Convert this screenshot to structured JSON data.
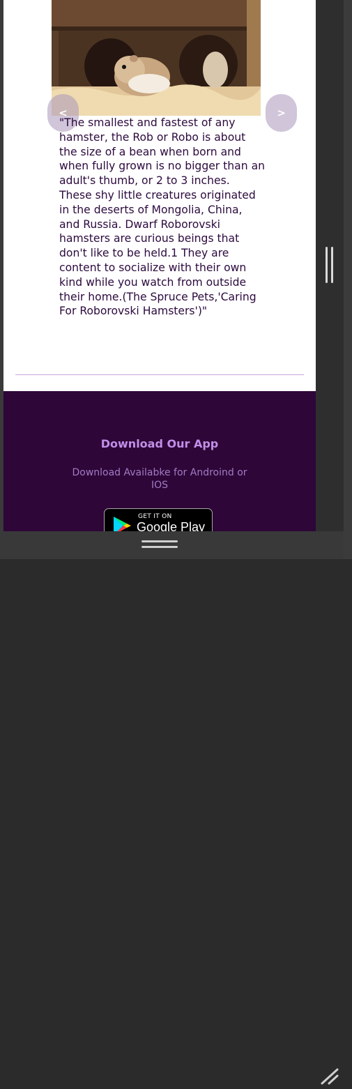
{
  "carousel": {
    "prev_label": "<",
    "next_label": ">"
  },
  "quote": {
    "text": "\"The smallest and fastest of any hamster, the Rob or Robo is about the size of a bean when born and when fully grown is no bigger than an adult's thumb, or 2 to 3 inches. These shy little creatures originated in the deserts of Mongolia, China, and Russia. Dwarf Roborovski hamsters are curious beings that don't like to be held.1 They are content to socialize with their own kind while you watch from outside their home.(The Spruce Pets,'Caring For Roborovski Hamsters')\""
  },
  "footer": {
    "title": "Download Our App",
    "description": "Download Availabke for Androind or IOS",
    "badge": {
      "small_text": "GET IT ON",
      "store_name": "Google Play"
    }
  },
  "colors": {
    "text_purple": "#2c0a3e",
    "footer_bg": "#2e0638",
    "footer_title": "#c08fe8",
    "footer_desc": "#a27bc4",
    "divider": "#c9a6e0"
  },
  "icons": {
    "play": "google-play-icon",
    "resize": "resize-grip-icon"
  }
}
